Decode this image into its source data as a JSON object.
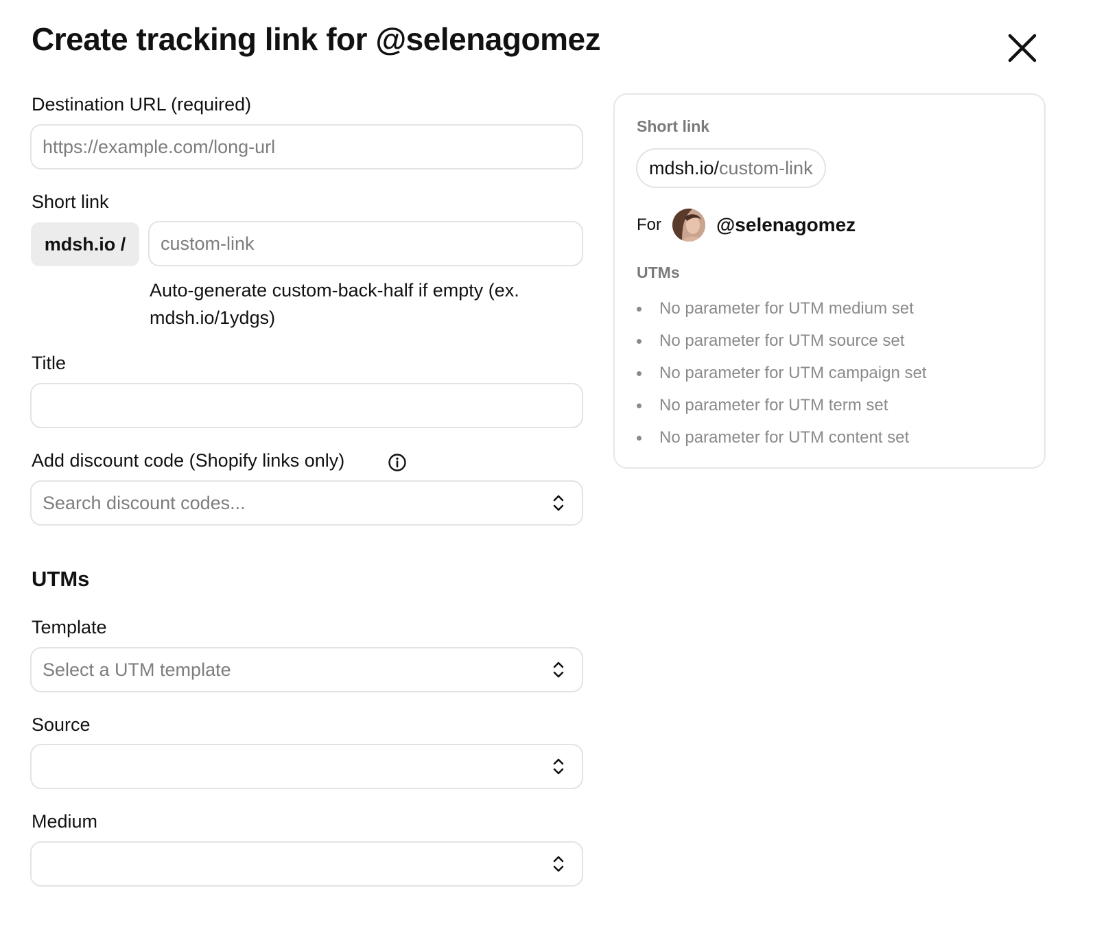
{
  "modal": {
    "title": "Create tracking link for @selenagomez"
  },
  "form": {
    "destination": {
      "label": "Destination URL (required)",
      "placeholder": "https://example.com/long-url",
      "value": ""
    },
    "short_link": {
      "label": "Short link",
      "prefix": "mdsh.io /",
      "placeholder": "custom-link",
      "help": "Auto-generate custom-back-half if empty (ex. mdsh.io/1ydgs)"
    },
    "title": {
      "label": "Title",
      "value": ""
    },
    "discount": {
      "label": "Add discount code (Shopify links only)",
      "placeholder": "Search discount codes..."
    },
    "utms": {
      "heading": "UTMs",
      "template_label": "Template",
      "template_placeholder": "Select a UTM template",
      "source_label": "Source",
      "source_value": "",
      "medium_label": "Medium",
      "medium_value": ""
    }
  },
  "preview": {
    "short_link_label": "Short link",
    "link_domain": "mdsh.io/",
    "link_slug": "custom-link",
    "for_label": "For",
    "handle": "@selenagomez",
    "utms_label": "UTMs",
    "utm_items": [
      "No parameter for UTM medium set",
      "No parameter for UTM source set",
      "No parameter for UTM campaign set",
      "No parameter for UTM term set",
      "No parameter for UTM content set"
    ]
  },
  "icons": {
    "close": "close-icon",
    "info": "info-icon",
    "select": "chevron-up-down-icon"
  }
}
